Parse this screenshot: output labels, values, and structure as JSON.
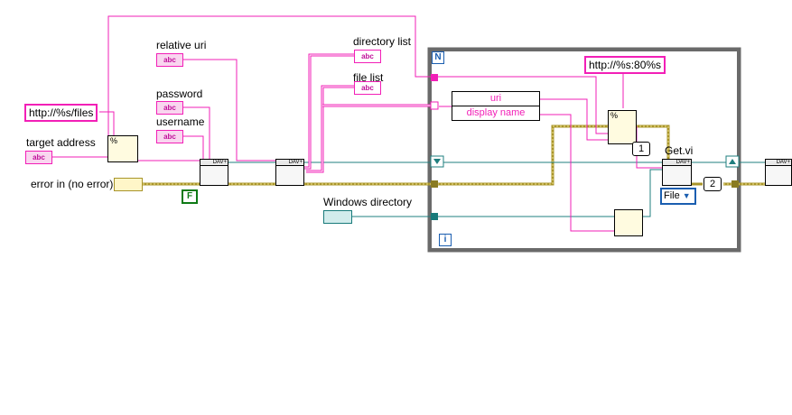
{
  "labels": {
    "relative_uri": "relative uri",
    "password": "password",
    "username": "username",
    "target_address": "target address",
    "error_in": "error in (no error)",
    "directory_list": "directory list",
    "file_list": "file list",
    "windows_directory": "Windows directory",
    "get_vi": "Get.vi"
  },
  "constants": {
    "url_format": "http://%s/files",
    "url_port_format": "http://%s:80%s",
    "false_const": "F",
    "index_1": "1",
    "index_2": "2",
    "enum_file": "File"
  },
  "unbundle": {
    "rows": [
      "uri",
      "display name"
    ]
  },
  "loop": {
    "count_terminal": "N",
    "iteration_terminal": "i"
  },
  "node_tags": {
    "dav": "DAV+",
    "fmt": "%",
    "str": "abc"
  },
  "colors": {
    "string_wire": "#f21fb7",
    "error_wire": "#b8a22a",
    "path_wire": "#187a7a",
    "refnum_wire": "#1f7f7f",
    "boolean": "#0d7a15",
    "loop_frame": "#555555"
  }
}
